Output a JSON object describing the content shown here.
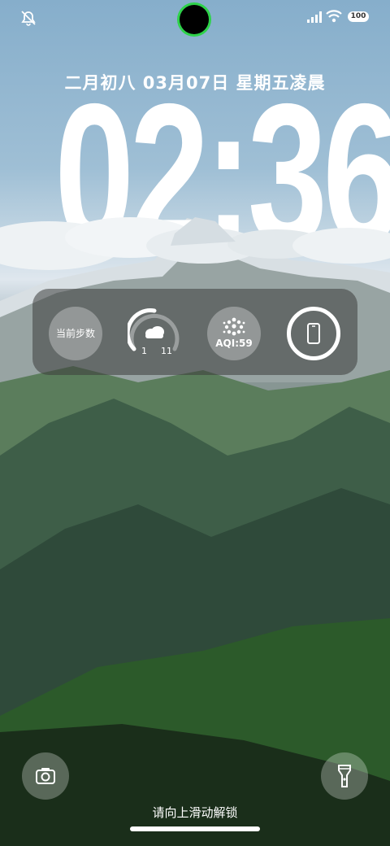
{
  "lockscreen": {
    "date_text": "二月初八  03月07日  星期五凌晨",
    "time": "02:36",
    "unlock_hint": "请向上滑动解锁"
  },
  "status_bar": {
    "battery": "100",
    "icons": [
      "notifications-muted-icon",
      "cellular-signal-icon",
      "wifi-icon",
      "battery-icon"
    ]
  },
  "widgets": {
    "steps_label": "当前步数",
    "weather_low": "1",
    "weather_high": "11",
    "aqi_label": "AQI:59",
    "icons": [
      "cloud-icon",
      "aqi-dots-icon",
      "phone-icon"
    ]
  },
  "colors": {
    "camera_ring": "#2ed24a",
    "text": "#ffffff"
  }
}
